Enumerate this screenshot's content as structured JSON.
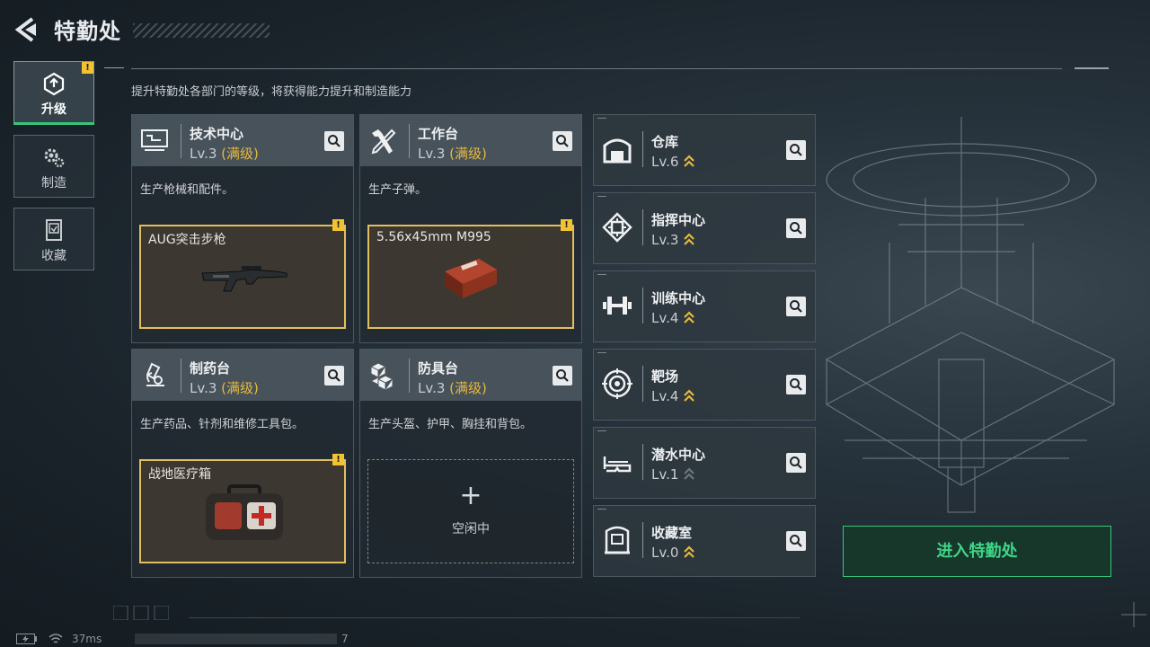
{
  "header": {
    "title": "特勤处"
  },
  "subtitle": "提升特勤处各部门的等级，将获得能力提升和制造能力",
  "nav": {
    "tabs": [
      {
        "label": "升级",
        "icon": "upgrade-icon",
        "active": true,
        "alert": "!"
      },
      {
        "label": "制造",
        "icon": "gear-icon",
        "active": false
      },
      {
        "label": "收藏",
        "icon": "collection-icon",
        "active": false
      }
    ]
  },
  "cards": [
    {
      "name": "技术中心",
      "level": "Lv.3",
      "max": "(满级)",
      "icon": "tech-center-icon",
      "desc": "生产枪械和配件。",
      "slot": {
        "name": "AUG突击步枪",
        "alert": "!"
      }
    },
    {
      "name": "工作台",
      "level": "Lv.3",
      "max": "(满级)",
      "icon": "workbench-icon",
      "desc": "生产子弹。",
      "slot": {
        "name": "5.56x45mm M995",
        "alert": "!"
      }
    },
    {
      "name": "制药台",
      "level": "Lv.3",
      "max": "(满级)",
      "icon": "pharmacy-icon",
      "desc": "生产药品、针剂和维修工具包。",
      "slot": {
        "name": "战地医疗箱",
        "alert": "!"
      }
    },
    {
      "name": "防具台",
      "level": "Lv.3",
      "max": "(满级)",
      "icon": "armor-bench-icon",
      "desc": "生产头盔、护甲、胸挂和背包。",
      "slot_empty": {
        "plus": "+",
        "label": "空闲中"
      }
    }
  ],
  "facilities": [
    {
      "name": "仓库",
      "level": "Lv.6",
      "icon": "warehouse-icon"
    },
    {
      "name": "指挥中心",
      "level": "Lv.3",
      "icon": "command-center-icon"
    },
    {
      "name": "训练中心",
      "level": "Lv.4",
      "icon": "training-center-icon"
    },
    {
      "name": "靶场",
      "level": "Lv.4",
      "icon": "shooting-range-icon"
    },
    {
      "name": "潜水中心",
      "level": "Lv.1",
      "icon": "diving-center-icon"
    },
    {
      "name": "收藏室",
      "level": "Lv.0",
      "icon": "collection-room-icon"
    }
  ],
  "enter_button": "进入特勤处",
  "status": {
    "ping": "37ms",
    "trailing": "7"
  },
  "colors": {
    "accent_green": "#35c77a",
    "gold": "#e6b93c",
    "alert_yellow": "#f1c232"
  }
}
